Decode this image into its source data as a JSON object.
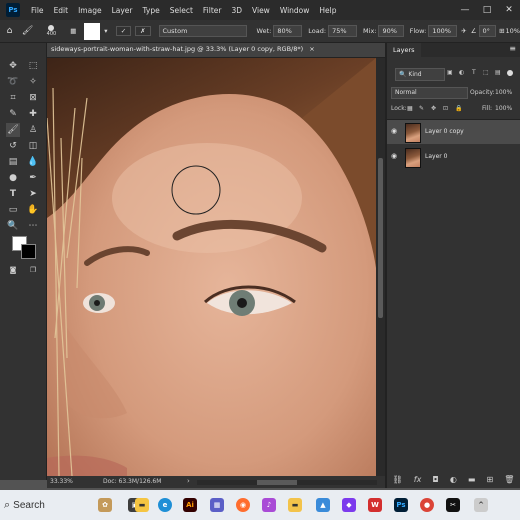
{
  "app": {
    "logo": "Ps"
  },
  "menu": [
    "File",
    "Edit",
    "Image",
    "Layer",
    "Type",
    "Select",
    "Filter",
    "3D",
    "View",
    "Window",
    "Help"
  ],
  "window_controls": {
    "minimize": "—",
    "maximize": "□",
    "close": "✕"
  },
  "options": {
    "brush_size": "400",
    "mode": "Custom",
    "wet_label": "Wet:",
    "wet_value": "80%",
    "load_label": "Load:",
    "load_value": "75%",
    "mix_label": "Mix:",
    "mix_value": "90%",
    "flow_label": "Flow:",
    "flow_value": "100%",
    "angle_value": "0°",
    "smoothing_value": "10%"
  },
  "document": {
    "tab_title": "sideways-portrait-woman-with-straw-hat.jpg @ 33.3% (Layer 0 copy, RGB/8*)",
    "tab_close": "×",
    "zoom": "33.33%",
    "doc_size": "Doc: 63.3M/126.6M"
  },
  "layers_panel": {
    "tab": "Layers",
    "kind_label": "Kind",
    "blend_mode": "Normal",
    "opacity_label": "Opacity:",
    "opacity_value": "100%",
    "lock_label": "Lock:",
    "fill_label": "Fill:",
    "fill_value": "100%",
    "layers": [
      {
        "name": "Layer 0 copy",
        "selected": true
      },
      {
        "name": "Layer 0",
        "selected": false
      }
    ],
    "bottom_icons": [
      "link-icon",
      "fx-icon",
      "mask-icon",
      "adjustment-icon",
      "group-icon",
      "new-layer-icon",
      "trash-icon"
    ]
  },
  "taskbar": {
    "search_label": "Search",
    "apps": [
      "file-explorer",
      "edge",
      "adobe-illustrator",
      "firefox",
      "podcasts",
      "files",
      "photos",
      "wps",
      "photoshop",
      "chrome",
      "capcut"
    ]
  },
  "colors": {
    "menubar": "#2b2b2b",
    "panel": "#323232",
    "accent": "#31a8ff"
  }
}
